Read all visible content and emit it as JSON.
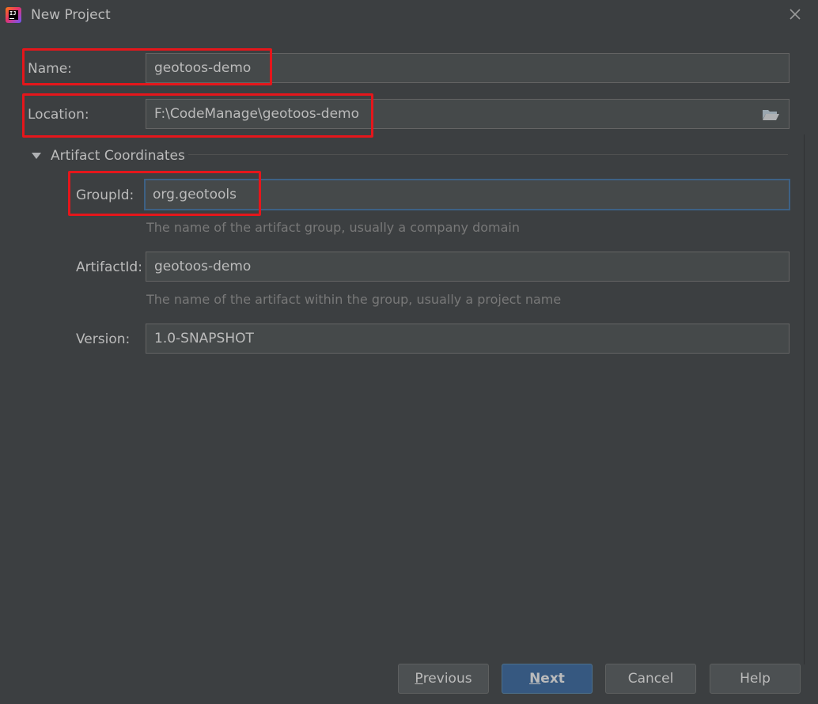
{
  "window": {
    "title": "New Project"
  },
  "form": {
    "name": {
      "label": "Name:",
      "value": "geotoos-demo"
    },
    "location": {
      "label": "Location:",
      "value": "F:\\CodeManage\\geotoos-demo"
    },
    "section": {
      "label": "Artifact Coordinates"
    },
    "group_id": {
      "label": "GroupId:",
      "value": "org.geotools",
      "hint": "The name of the artifact group, usually a company domain"
    },
    "artifact_id": {
      "label": "ArtifactId:",
      "value": "geotoos-demo",
      "hint": "The name of the artifact within the group, usually a project name"
    },
    "version": {
      "label": "Version:",
      "value": "1.0-SNAPSHOT"
    }
  },
  "buttons": {
    "previous": {
      "mnemonic": "P",
      "rest": "revious"
    },
    "next": {
      "mnemonic": "N",
      "rest": "ext"
    },
    "cancel": "Cancel",
    "help": "Help"
  },
  "colors": {
    "background": "#3c3f41",
    "field": "#45494a",
    "focus": "#3d6185",
    "primary_button": "#365880",
    "highlight": "#e5161b"
  },
  "icons": [
    "intellij-app-icon",
    "close-icon",
    "folder-icon",
    "collapse-triangle-icon"
  ]
}
